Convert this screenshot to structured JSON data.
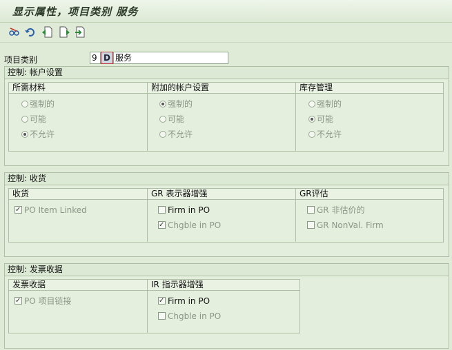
{
  "title": "显示属性，项目类别 服务",
  "toolbar": {
    "icons": [
      "glasses-icon",
      "undo-icon",
      "previous-entry-icon",
      "next-entry-icon",
      "other-entry-icon"
    ]
  },
  "item_category": {
    "label": "项目类别",
    "code_part1": "9",
    "code_part2": "D",
    "description": "服务"
  },
  "sections": {
    "account": {
      "title": "控制: 帐户设置",
      "materials": {
        "title": "所需材料",
        "options": [
          "强制的",
          "可能",
          "不允许"
        ],
        "selected": 2
      },
      "attached_account": {
        "title": "附加的帐户设置",
        "options": [
          "强制的",
          "可能",
          "不允许"
        ],
        "selected": 0
      },
      "inventory": {
        "title": "库存管理",
        "options": [
          "强制的",
          "可能",
          "不允许"
        ],
        "selected": 1
      }
    },
    "goods_receipt": {
      "title": "控制: 收货",
      "receipt": {
        "title": "收货",
        "items": [
          {
            "label": "PO Item Linked",
            "checked": true,
            "enabled": false
          }
        ]
      },
      "gr_indicator": {
        "title": "GR 表示器增强",
        "items": [
          {
            "label": "Firm in PO",
            "checked": false,
            "enabled": true
          },
          {
            "label": "Chgble in PO",
            "checked": true,
            "enabled": false
          }
        ]
      },
      "gr_valuation": {
        "title": "GR评估",
        "items": [
          {
            "label": "GR 非估价的",
            "checked": false,
            "enabled": false
          },
          {
            "label": "GR NonVal. Firm",
            "checked": false,
            "enabled": false
          }
        ]
      }
    },
    "invoice": {
      "title": "控制: 发票收据",
      "receipt": {
        "title": "发票收据",
        "items": [
          {
            "label": "PO 项目链接",
            "checked": true,
            "enabled": false
          }
        ]
      },
      "ir_indicator": {
        "title": "IR 指示器增强",
        "items": [
          {
            "label": "Firm in PO",
            "checked": true,
            "enabled": true
          },
          {
            "label": "Chgble in PO",
            "checked": false,
            "enabled": false
          }
        ]
      }
    }
  }
}
